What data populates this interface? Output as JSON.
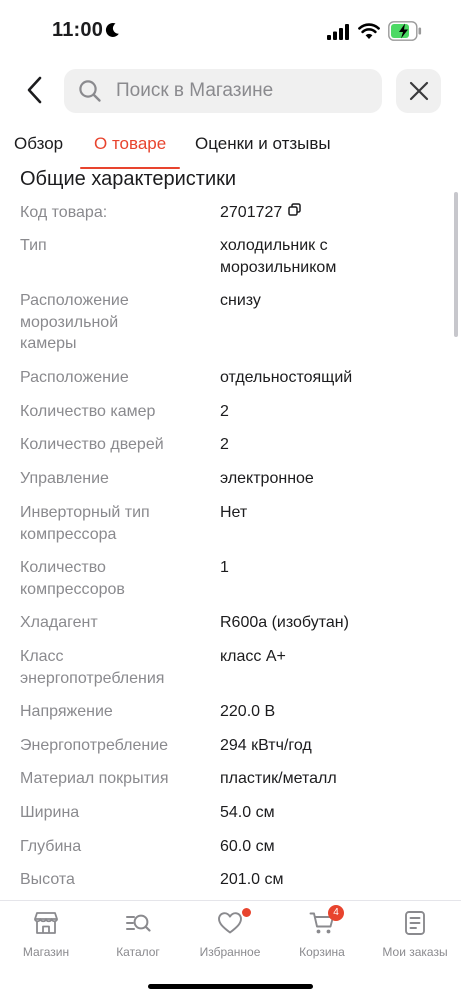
{
  "status": {
    "time": "11:00"
  },
  "search": {
    "placeholder": "Поиск в Магазине"
  },
  "tabs": [
    {
      "label": "Обзор",
      "active": false
    },
    {
      "label": "О товаре",
      "active": true
    },
    {
      "label": "Оценки и отзывы",
      "active": false
    }
  ],
  "section": {
    "title": "Общие характеристики"
  },
  "specs": [
    {
      "label": "Код товара:",
      "value": "2701727"
    },
    {
      "label": "Тип",
      "value": "холодильник с морозильником"
    },
    {
      "label": "Расположение морозильной камеры",
      "value": "снизу"
    },
    {
      "label": "Расположение",
      "value": "отдельностоящий"
    },
    {
      "label": "Количество камер",
      "value": "2"
    },
    {
      "label": "Количество дверей",
      "value": "2"
    },
    {
      "label": "Управление",
      "value": "электронное"
    },
    {
      "label": "Инверторный тип компрессора",
      "value": "Нет"
    },
    {
      "label": "Количество компрессоров",
      "value": "1"
    },
    {
      "label": "Хладагент",
      "value": "R600a (изобутан)"
    },
    {
      "label": "Класс энергопотребления",
      "value": "класс A+"
    },
    {
      "label": "Напряжение",
      "value": "220.0 В"
    },
    {
      "label": "Энергопотребление",
      "value": "294 кВтч/год"
    },
    {
      "label": "Материал покрытия",
      "value": "пластик/металл"
    },
    {
      "label": "Ширина",
      "value": "54.0 см"
    },
    {
      "label": "Глубина",
      "value": "60.0 см"
    },
    {
      "label": "Высота",
      "value": "201.0 см"
    }
  ],
  "nav": [
    {
      "label": "Магазин",
      "icon": "store-icon"
    },
    {
      "label": "Каталог",
      "icon": "catalog-search-icon"
    },
    {
      "label": "Избранное",
      "icon": "heart-icon",
      "dot": true
    },
    {
      "label": "Корзина",
      "icon": "cart-icon",
      "badge": "4"
    },
    {
      "label": "Мои заказы",
      "icon": "orders-icon"
    }
  ],
  "colors": {
    "accent": "#e8442e",
    "muted": "#8a8a8e",
    "text": "#1c1c1e",
    "battery": "#4cd964"
  }
}
